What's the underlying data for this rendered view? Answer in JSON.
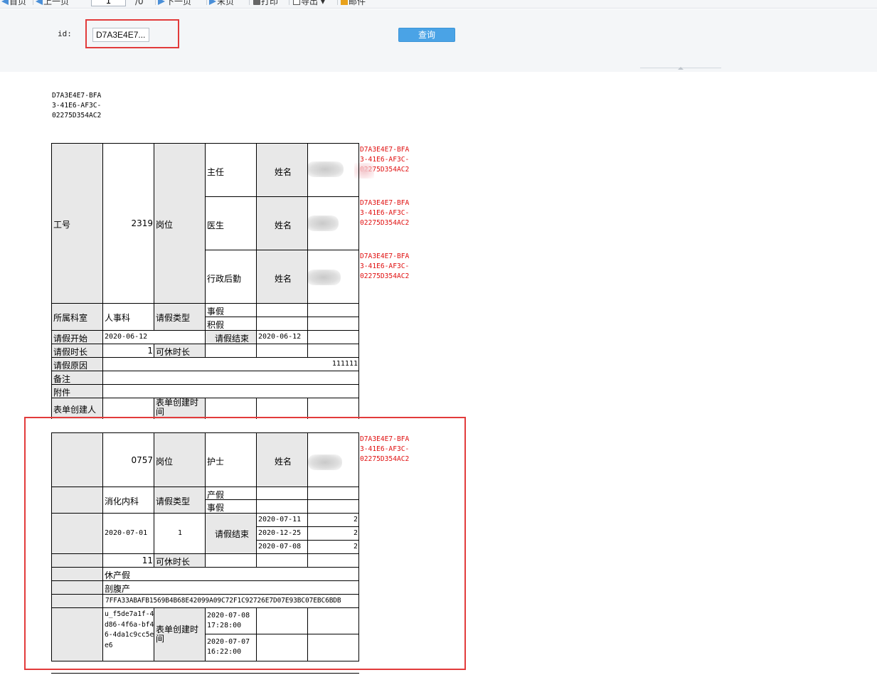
{
  "toolbar": {
    "first": "首页",
    "prev": "上一页",
    "page": "1",
    "page_total": "/0",
    "next": "下一页",
    "last": "末页",
    "print": "打印",
    "export": "导出",
    "mail": "邮件"
  },
  "query": {
    "id_label": "id:",
    "id_value": "D7A3E4E7...",
    "button": "查询"
  },
  "report": {
    "record_id": "D7A3E4E7-BFA3-41E6-AF3C-02275D354AC2",
    "record1": {
      "emp_no_label": "工号",
      "emp_no": "2319",
      "position_label": "岗位",
      "roles": [
        {
          "role": "主任",
          "name_label": "姓名",
          "side_id": "D7A3E4E7-BFA3-41E6-AF3C-02275D354AC2"
        },
        {
          "role": "医生",
          "name_label": "姓名",
          "side_id": "D7A3E4E7-BFA3-41E6-AF3C-02275D354AC2"
        },
        {
          "role": "行政后勤",
          "name_label": "姓名",
          "side_id": "D7A3E4E7-BFA3-41E6-AF3C-02275D354AC2"
        }
      ],
      "dept_label": "所属科室",
      "dept": "人事科",
      "leave_type_label": "请假类型",
      "leave_types": [
        "事假",
        "积假"
      ],
      "start_label": "请假开始",
      "start": "2020-06-12",
      "end_label": "请假结束",
      "end": "2020-06-12",
      "duration_label": "请假时长",
      "duration": "1",
      "avail_label": "可休时长",
      "reason_label": "请假原因",
      "reason": "111111",
      "remark_label": "备注",
      "attach_label": "附件",
      "creator_label": "表单创建人",
      "created_label": "表单创建时间"
    },
    "record2": {
      "emp_no": "0757",
      "position_label": "岗位",
      "role": "护士",
      "name_label": "姓名",
      "side_id": "D7A3E4E7-BFA3-41E6-AF3C-02275D354AC2",
      "dept": "消化内科",
      "leave_type_label": "请假类型",
      "leave_types": [
        "产假",
        "事假"
      ],
      "start": "2020-07-01",
      "duration": "1",
      "end_label": "请假结束",
      "ends": [
        {
          "date": "2020-07-11",
          "value": "2"
        },
        {
          "date": "2020-12-25",
          "value": "2"
        },
        {
          "date": "2020-07-08",
          "value": "2"
        }
      ],
      "duration2": "11",
      "avail_label": "可休时长",
      "reason": "休产假",
      "remark": "剖腹产",
      "attach": "7FFA33ABAFB1569B4B68E42099A09C72F1C92726E7D07E93BC07EBC6BDB",
      "creator": "u_f5de7a1f-4d86-4f6a-bf46-4da1c9cc5ee6",
      "created_label": "表单创建时间",
      "created_times": [
        "2020-07-08 17:28:00",
        "2020-07-07 16:22:00"
      ]
    }
  }
}
